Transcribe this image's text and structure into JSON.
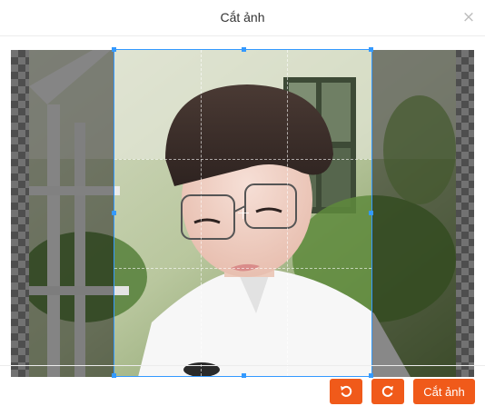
{
  "dialog": {
    "title": "Cắt ảnh",
    "close_glyph": "×"
  },
  "cropper": {
    "photo_alt": "Ảnh cần cắt",
    "icons": [
      "rotate-left-icon",
      "rotate-right-icon",
      "close-icon"
    ]
  },
  "footer": {
    "crop_label": "Cắt ảnh"
  },
  "colors": {
    "accent": "#f05a1a",
    "crop_border": "#3399ff"
  }
}
